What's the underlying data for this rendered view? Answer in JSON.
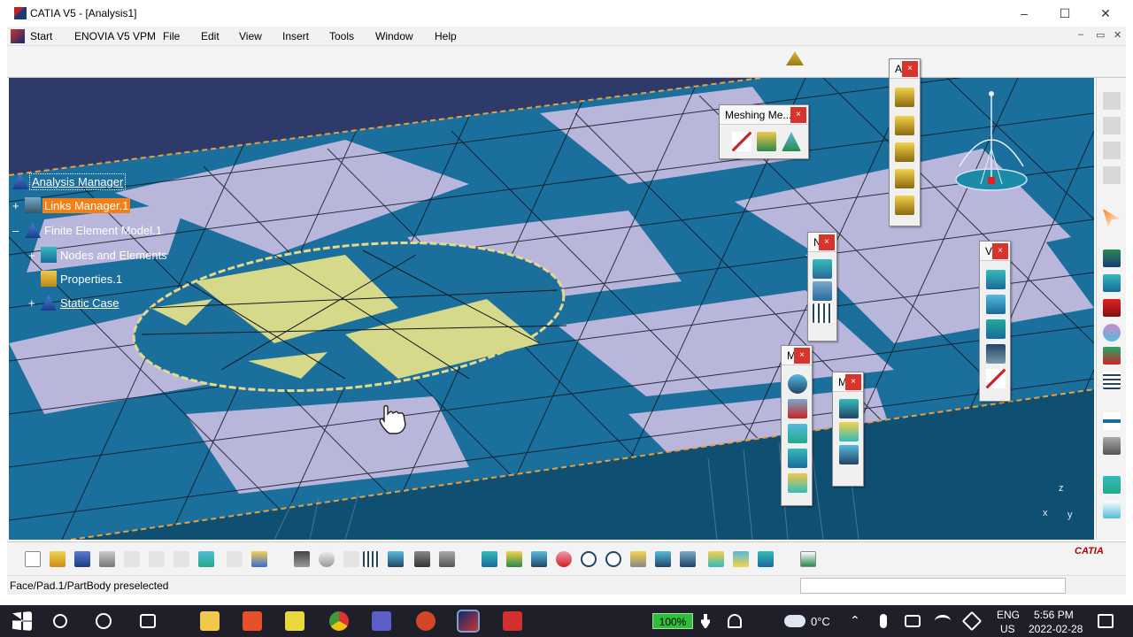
{
  "window": {
    "title": "CATIA V5 - [Analysis1]",
    "minimize_glyph": "–",
    "maximize_glyph": "☐",
    "close_glyph": "✕"
  },
  "menu": {
    "items": [
      "Start",
      "ENOVIA V5 VPM",
      "File",
      "Edit",
      "View",
      "Insert",
      "Tools",
      "Window",
      "Help"
    ],
    "mdi": [
      "–",
      "▭",
      "✕"
    ]
  },
  "tree": {
    "root": "Analysis Manager",
    "links": "Links Manager.1",
    "fem": "Finite Element Model.1",
    "nodes": "Nodes and Elements",
    "properties": "Properties.1",
    "static_case": "Static Case",
    "expander_plus": "+",
    "expander_minus": "–"
  },
  "floating_toolbars": {
    "meshing": {
      "title": "Meshing Me...",
      "close": "×"
    },
    "a": {
      "title": "A",
      "close": "×"
    },
    "n1": {
      "title": "N",
      "close": "×"
    },
    "v": {
      "title": "V",
      "close": "×"
    },
    "m1": {
      "title": "M",
      "close": "×"
    },
    "m2": {
      "title": "M",
      "close": "×"
    }
  },
  "compass": {
    "z_label": "z",
    "y_label": "y",
    "x_label": "x"
  },
  "status": {
    "message": "Face/Pad.1/PartBody preselected",
    "command_value": ""
  },
  "taskbar": {
    "battery": "100%",
    "temperature": "0°C",
    "lang1": "ENG",
    "lang2": "US",
    "time": "5:56 PM",
    "date": "2022-02-28"
  },
  "colors": {
    "mesh_blue": "#1b6f9c",
    "mesh_lilac": "#b9b6dc",
    "selection_yellow": "#d7d98a",
    "viewport_bg": "#2d3a6a",
    "tree_highlight": "#f57f17",
    "close_red": "#d9342b"
  },
  "logo": {
    "text": "CATIA"
  }
}
